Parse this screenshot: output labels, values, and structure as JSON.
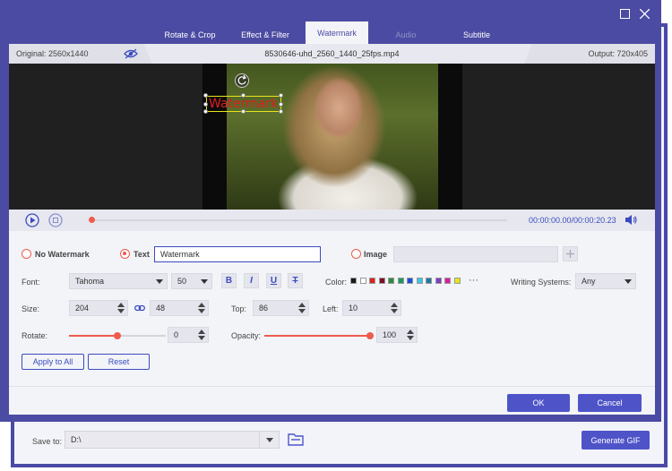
{
  "dialog": {
    "tabs": [
      {
        "label": "Rotate & Crop",
        "state": "normal"
      },
      {
        "label": "Effect & Filter",
        "state": "normal"
      },
      {
        "label": "Watermark",
        "state": "active"
      },
      {
        "label": "Audio",
        "state": "disabled"
      },
      {
        "label": "Subtitle",
        "state": "normal"
      }
    ]
  },
  "info": {
    "original": "Original: 2560x1440",
    "filename": "8530646-uhd_2560_1440_25fps.mp4",
    "output": "Output: 720x405"
  },
  "preview": {
    "watermark_text": "Watermark"
  },
  "player": {
    "time": "00:00:00.00/00:00:20.23",
    "progress": 0
  },
  "watermark": {
    "no_watermark_label": "No Watermark",
    "text_label": "Text",
    "text_value": "Watermark",
    "image_label": "Image",
    "selected": "text"
  },
  "font": {
    "label": "Font:",
    "family": "Tahoma",
    "size": "50",
    "bold_label": "B",
    "italic_label": "I",
    "underline_label": "U",
    "strike_label": "T",
    "color_label": "Color:",
    "colors": [
      "#1a1a1a",
      "#ffffff",
      "#e01e1e",
      "#7a1020",
      "#2a8c3a",
      "#1a9a5a",
      "#1f4fd8",
      "#39c5e8",
      "#1f7aa0",
      "#7b3fc4",
      "#d81e9e",
      "#e6e61a"
    ],
    "more_label": "···",
    "writing_label": "Writing Systems:",
    "writing_value": "Any"
  },
  "size": {
    "label": "Size:",
    "width": "204",
    "height": "48",
    "top_label": "Top:",
    "top": "86",
    "left_label": "Left:",
    "left": "10"
  },
  "rotate": {
    "label": "Rotate:",
    "value": "0",
    "slider_fraction": 0.5,
    "opacity_label": "Opacity:",
    "opacity": "100",
    "opacity_fraction": 1.0
  },
  "buttons": {
    "apply_all": "Apply to All",
    "reset": "Reset",
    "ok": "OK",
    "cancel": "Cancel"
  },
  "bottom": {
    "save_to_label": "Save to:",
    "save_to_value": "D:\\",
    "generate": "Generate GIF"
  },
  "colors": {
    "accent": "#4e54c8",
    "frame": "#4b4ba3",
    "highlight": "#ef5b4d"
  }
}
